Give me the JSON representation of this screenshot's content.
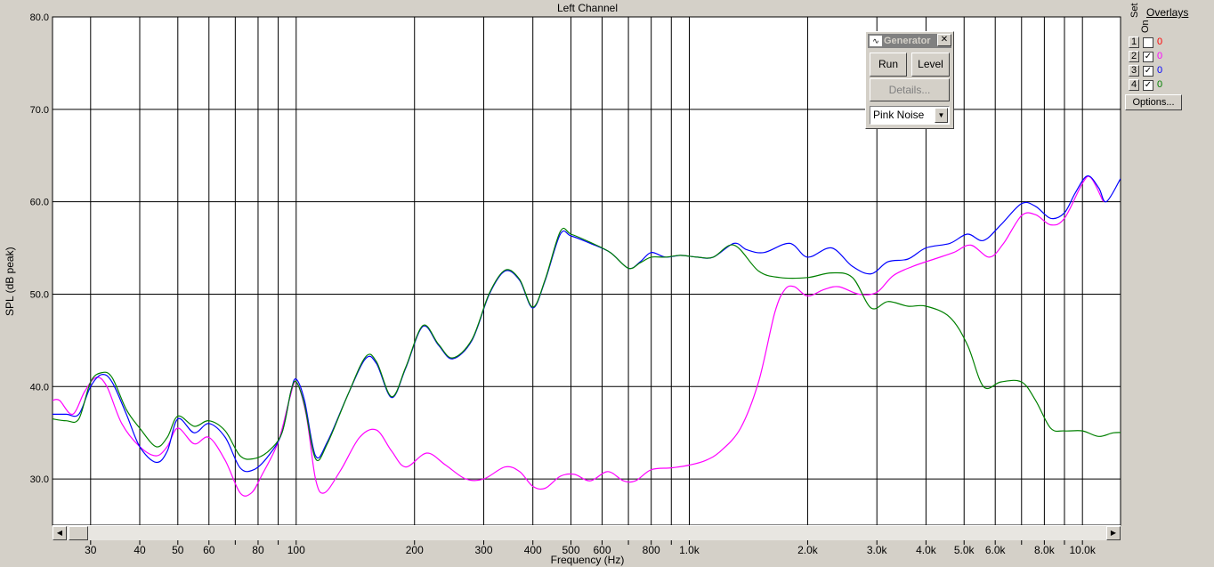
{
  "window": {
    "title": "Left Channel"
  },
  "axes": {
    "ylabel": "SPL (dB peak)",
    "xlabel": "Frequency (Hz)"
  },
  "generator": {
    "title": "Generator",
    "close_label": "✕",
    "run_label": "Run",
    "level_label": "Level",
    "details_label": "Details...",
    "signal": "Pink Noise"
  },
  "overlays": {
    "title": "Overlays",
    "set_label": "Set",
    "on_label": "On",
    "options_label": "Options...",
    "rows": [
      {
        "num": "1",
        "checked": false,
        "value": "0",
        "color": "#ff0000"
      },
      {
        "num": "2",
        "checked": true,
        "value": "0",
        "color": "#ff00ff"
      },
      {
        "num": "3",
        "checked": true,
        "value": "0",
        "color": "#0000ff"
      },
      {
        "num": "4",
        "checked": true,
        "value": "0",
        "color": "#008000"
      }
    ]
  },
  "chart_data": {
    "type": "line",
    "title": "Left Channel",
    "xlabel": "Frequency (Hz)",
    "ylabel": "SPL (dB peak)",
    "xscale": "log",
    "xlim": [
      24,
      12500
    ],
    "ylim": [
      25,
      80
    ],
    "grid": true,
    "yticks": [
      30,
      40,
      50,
      60,
      70,
      80
    ],
    "ytick_labels": [
      "30.0",
      "40.0",
      "50.0",
      "60.0",
      "70.0",
      "80.0"
    ],
    "xticks": [
      30,
      40,
      50,
      60,
      70,
      80,
      90,
      100,
      200,
      300,
      400,
      500,
      600,
      700,
      800,
      900,
      1000,
      2000,
      3000,
      4000,
      5000,
      6000,
      7000,
      8000,
      9000,
      10000
    ],
    "xtick_labels": [
      "30",
      "40",
      "50",
      "60",
      "",
      "80",
      "",
      "100",
      "200",
      "300",
      "400",
      "500",
      "600",
      "",
      "800",
      "",
      "1.0k",
      "2.0k",
      "3.0k",
      "4.0k",
      "5.0k",
      "6.0k",
      "",
      "8.0k",
      "",
      "10.0k"
    ],
    "series": [
      {
        "color": "#ff00ff",
        "points": [
          [
            24,
            38.5
          ],
          [
            25,
            38.5
          ],
          [
            27,
            37.0
          ],
          [
            29,
            39.5
          ],
          [
            31,
            41.0
          ],
          [
            33,
            40.0
          ],
          [
            36,
            36.0
          ],
          [
            40,
            33.5
          ],
          [
            44,
            32.5
          ],
          [
            47,
            33.5
          ],
          [
            50,
            35.5
          ],
          [
            55,
            33.8
          ],
          [
            60,
            34.5
          ],
          [
            66,
            32.0
          ],
          [
            72,
            28.5
          ],
          [
            77,
            28.5
          ],
          [
            82,
            30.5
          ],
          [
            90,
            34.0
          ],
          [
            96,
            38.5
          ],
          [
            100,
            40.5
          ],
          [
            106,
            37.0
          ],
          [
            112,
            30.0
          ],
          [
            118,
            28.5
          ],
          [
            130,
            31.0
          ],
          [
            145,
            34.5
          ],
          [
            160,
            35.3
          ],
          [
            175,
            33.0
          ],
          [
            190,
            31.3
          ],
          [
            215,
            32.8
          ],
          [
            240,
            31.5
          ],
          [
            270,
            30.0
          ],
          [
            300,
            30.0
          ],
          [
            340,
            31.3
          ],
          [
            370,
            30.8
          ],
          [
            400,
            29.2
          ],
          [
            430,
            29.0
          ],
          [
            470,
            30.3
          ],
          [
            510,
            30.5
          ],
          [
            560,
            29.8
          ],
          [
            620,
            30.8
          ],
          [
            680,
            29.8
          ],
          [
            730,
            29.8
          ],
          [
            800,
            31.0
          ],
          [
            900,
            31.2
          ],
          [
            1000,
            31.5
          ],
          [
            1100,
            32.0
          ],
          [
            1200,
            33.0
          ],
          [
            1350,
            35.5
          ],
          [
            1500,
            40.5
          ],
          [
            1650,
            48.0
          ],
          [
            1750,
            50.5
          ],
          [
            1850,
            50.8
          ],
          [
            2000,
            49.8
          ],
          [
            2200,
            50.5
          ],
          [
            2400,
            50.8
          ],
          [
            2700,
            50.0
          ],
          [
            3000,
            50.2
          ],
          [
            3300,
            52.0
          ],
          [
            3700,
            53.0
          ],
          [
            4200,
            53.8
          ],
          [
            4700,
            54.5
          ],
          [
            5200,
            55.3
          ],
          [
            5800,
            54.0
          ],
          [
            6300,
            55.5
          ],
          [
            7000,
            58.5
          ],
          [
            7600,
            58.6
          ],
          [
            8300,
            57.5
          ],
          [
            9000,
            58.2
          ],
          [
            10000,
            62.0
          ],
          [
            10500,
            62.6
          ],
          [
            11300,
            60.0
          ]
        ]
      },
      {
        "color": "#0000ff",
        "points": [
          [
            24,
            37.0
          ],
          [
            26,
            37.0
          ],
          [
            28,
            37.0
          ],
          [
            30,
            40.0
          ],
          [
            32,
            41.3
          ],
          [
            34,
            40.5
          ],
          [
            37,
            37.0
          ],
          [
            40,
            33.5
          ],
          [
            44,
            31.8
          ],
          [
            47,
            33.0
          ],
          [
            50,
            36.5
          ],
          [
            55,
            35.0
          ],
          [
            60,
            36.0
          ],
          [
            66,
            34.5
          ],
          [
            72,
            31.2
          ],
          [
            78,
            31.0
          ],
          [
            85,
            32.5
          ],
          [
            92,
            35.0
          ],
          [
            97,
            39.5
          ],
          [
            100,
            40.8
          ],
          [
            105,
            38.5
          ],
          [
            112,
            32.5
          ],
          [
            120,
            34.0
          ],
          [
            135,
            39.0
          ],
          [
            150,
            43.0
          ],
          [
            160,
            42.5
          ],
          [
            175,
            38.8
          ],
          [
            190,
            42.0
          ],
          [
            210,
            46.5
          ],
          [
            230,
            44.5
          ],
          [
            250,
            43.0
          ],
          [
            280,
            45.0
          ],
          [
            310,
            50.0
          ],
          [
            340,
            52.5
          ],
          [
            370,
            51.5
          ],
          [
            400,
            48.5
          ],
          [
            430,
            51.5
          ],
          [
            470,
            56.5
          ],
          [
            500,
            56.3
          ],
          [
            560,
            55.5
          ],
          [
            630,
            54.5
          ],
          [
            700,
            52.8
          ],
          [
            750,
            53.5
          ],
          [
            800,
            54.5
          ],
          [
            870,
            54.0
          ],
          [
            950,
            54.2
          ],
          [
            1050,
            54.0
          ],
          [
            1150,
            54.0
          ],
          [
            1300,
            55.5
          ],
          [
            1400,
            54.8
          ],
          [
            1550,
            54.5
          ],
          [
            1800,
            55.5
          ],
          [
            2000,
            54.0
          ],
          [
            2300,
            55.0
          ],
          [
            2600,
            53.0
          ],
          [
            2900,
            52.2
          ],
          [
            3200,
            53.5
          ],
          [
            3600,
            53.8
          ],
          [
            4000,
            55.0
          ],
          [
            4600,
            55.5
          ],
          [
            5100,
            56.5
          ],
          [
            5600,
            55.8
          ],
          [
            6200,
            57.5
          ],
          [
            7000,
            59.8
          ],
          [
            7600,
            59.5
          ],
          [
            8300,
            58.2
          ],
          [
            9000,
            58.8
          ],
          [
            9600,
            61.0
          ],
          [
            10300,
            62.8
          ],
          [
            11000,
            61.5
          ],
          [
            11500,
            60.0
          ],
          [
            12500,
            62.5
          ]
        ]
      },
      {
        "color": "#008000",
        "points": [
          [
            24,
            36.5
          ],
          [
            26,
            36.3
          ],
          [
            28,
            36.5
          ],
          [
            30,
            40.5
          ],
          [
            32,
            41.5
          ],
          [
            34,
            41.0
          ],
          [
            37,
            37.5
          ],
          [
            40,
            35.5
          ],
          [
            44,
            33.5
          ],
          [
            47,
            34.5
          ],
          [
            50,
            36.8
          ],
          [
            55,
            35.7
          ],
          [
            60,
            36.3
          ],
          [
            66,
            35.2
          ],
          [
            72,
            32.5
          ],
          [
            78,
            32.2
          ],
          [
            85,
            33.0
          ],
          [
            92,
            35.0
          ],
          [
            97,
            39.5
          ],
          [
            100,
            40.5
          ],
          [
            105,
            38.0
          ],
          [
            112,
            32.2
          ],
          [
            120,
            33.8
          ],
          [
            135,
            39.0
          ],
          [
            150,
            43.2
          ],
          [
            160,
            42.7
          ],
          [
            175,
            38.9
          ],
          [
            190,
            42.1
          ],
          [
            210,
            46.6
          ],
          [
            230,
            44.6
          ],
          [
            250,
            43.1
          ],
          [
            280,
            45.1
          ],
          [
            310,
            50.1
          ],
          [
            340,
            52.6
          ],
          [
            370,
            51.6
          ],
          [
            400,
            48.6
          ],
          [
            430,
            51.6
          ],
          [
            470,
            56.8
          ],
          [
            500,
            56.5
          ],
          [
            560,
            55.6
          ],
          [
            630,
            54.5
          ],
          [
            700,
            52.8
          ],
          [
            750,
            53.4
          ],
          [
            800,
            54.0
          ],
          [
            870,
            54.0
          ],
          [
            950,
            54.2
          ],
          [
            1050,
            54.0
          ],
          [
            1150,
            54.0
          ],
          [
            1300,
            55.3
          ],
          [
            1500,
            52.5
          ],
          [
            1700,
            51.8
          ],
          [
            2000,
            51.8
          ],
          [
            2300,
            52.3
          ],
          [
            2600,
            51.8
          ],
          [
            2900,
            48.5
          ],
          [
            3200,
            49.2
          ],
          [
            3600,
            48.7
          ],
          [
            4000,
            48.7
          ],
          [
            4600,
            47.5
          ],
          [
            5100,
            44.5
          ],
          [
            5600,
            40.0
          ],
          [
            6200,
            40.5
          ],
          [
            7000,
            40.5
          ],
          [
            7600,
            38.5
          ],
          [
            8300,
            35.5
          ],
          [
            9000,
            35.2
          ],
          [
            10000,
            35.2
          ],
          [
            11000,
            34.6
          ],
          [
            12000,
            35.0
          ],
          [
            13000,
            35.0
          ]
        ]
      }
    ]
  }
}
